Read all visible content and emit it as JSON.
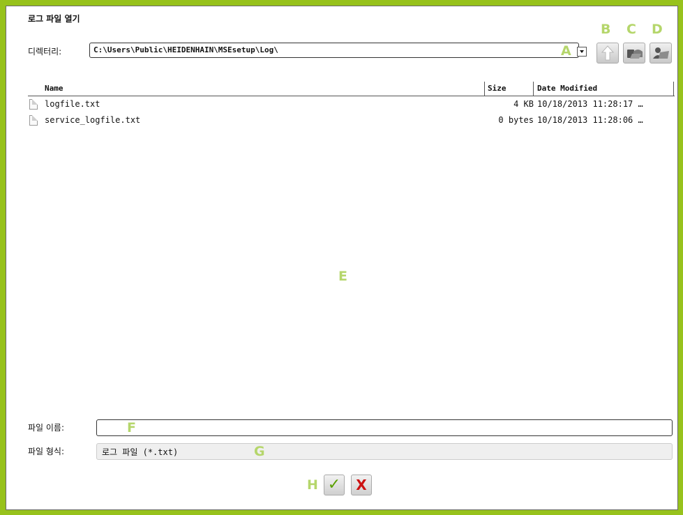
{
  "dialog": {
    "title": "로그 파일 열기",
    "directory_label": "디렉터리:",
    "directory_path": "C:\\Users\\Public\\HEIDENHAIN\\MSEsetup\\Log\\"
  },
  "toolbar": {
    "up_icon": "up-arrow-icon",
    "network_icon": "network-folder-icon",
    "user_icon": "user-folder-icon"
  },
  "callouts": {
    "a": "A",
    "b": "B",
    "c": "C",
    "d": "D",
    "e": "E",
    "f": "F",
    "g": "G",
    "h": "H"
  },
  "file_list": {
    "columns": [
      "Name",
      "Size",
      "Date Modified"
    ],
    "rows": [
      {
        "name": "logfile.txt",
        "size": "4 KB",
        "date": "10/18/2013 11:28:17 …"
      },
      {
        "name": "service_logfile.txt",
        "size": "0 bytes",
        "date": "10/18/2013 11:28:06 …"
      }
    ]
  },
  "bottom": {
    "filename_label": "파일 이름:",
    "filename_value": "",
    "filetype_label": "파일 형식:",
    "filetype_value": "로그 파일 (*.txt)"
  },
  "actions": {
    "ok_glyph": "✓",
    "cancel_glyph": "X"
  },
  "colors": {
    "frame": "#97c21c",
    "callout": "#b5d66b",
    "ok": "#5aa000",
    "cancel": "#cc1111"
  }
}
